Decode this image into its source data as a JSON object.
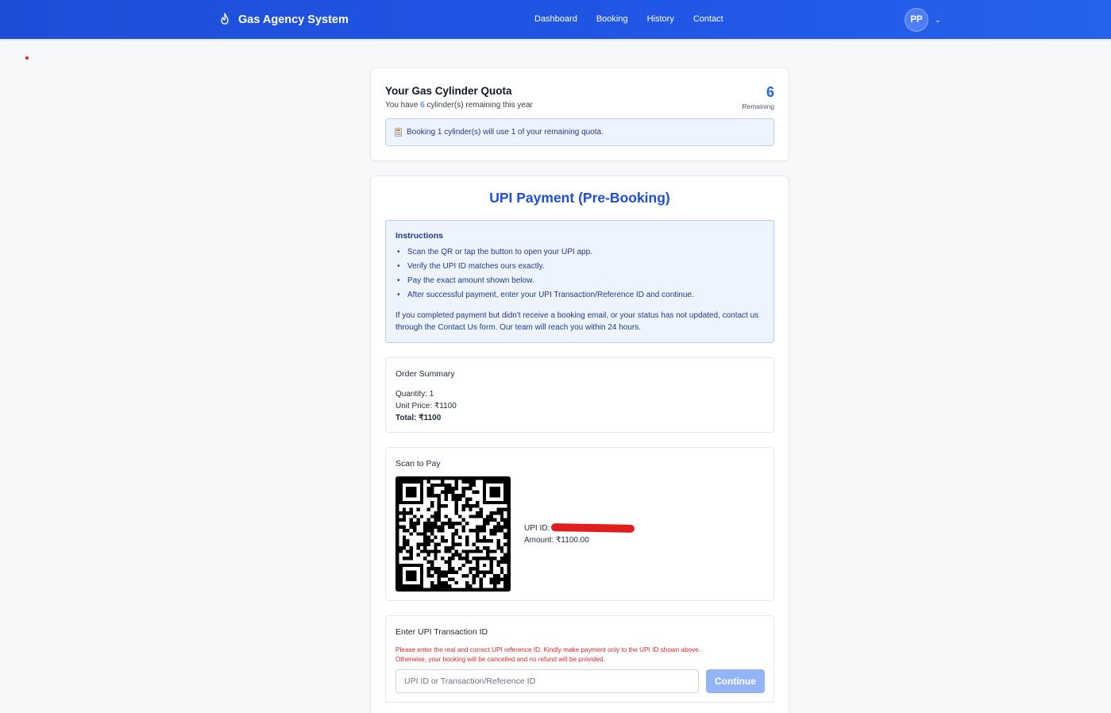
{
  "nav": {
    "brand": "Gas Agency System",
    "links": [
      "Dashboard",
      "Booking",
      "History",
      "Contact"
    ],
    "avatar_initials": "PP"
  },
  "quota": {
    "title": "Your Gas Cylinder Quota",
    "sub_prefix": "You have",
    "remaining": "6",
    "sub_suffix": "cylinder(s) remaining this year",
    "remaining_label": "Remaining",
    "note": "Booking 1 cylinder(s) will use 1 of your remaining quota."
  },
  "payment": {
    "title": "UPI Payment (Pre-Booking)",
    "instructions_title": "Instructions",
    "instructions": [
      "Scan the QR or tap the button to open your UPI app.",
      "Verify the UPI ID matches ours exactly.",
      "Pay the exact amount shown below.",
      "After successful payment, enter your UPI Transaction/Reference ID and continue."
    ],
    "help_text": "If you completed payment but didn't receive a booking email, or your status has not updated, contact us through the Contact Us form. Our team will reach you within 24 hours."
  },
  "summary": {
    "title": "Order Summary",
    "quantity": "Quantity: 1",
    "unit_price": "Unit Price: ₹1100",
    "total": "Total: ₹1100"
  },
  "scan": {
    "title": "Scan to Pay",
    "upi_label": "UPI ID:",
    "amount": "Amount: ₹1100.00"
  },
  "txn": {
    "title": "Enter UPI Transaction ID",
    "warning_line1": "Please enter the real and correct UPI reference ID. Kindly make payment only to the UPI ID shown above.",
    "warning_line2": "Otherwise, your booking will be cancelled and no refund will be provided.",
    "placeholder": "UPI ID or Transaction/Reference ID",
    "button": "Continue"
  },
  "colors": {
    "primary": "#2563eb",
    "navbar": "#1d4ed8",
    "warning": "#dc2626",
    "redaction": "#e11d1d",
    "button_disabled": "#93b4f7"
  },
  "icons": {
    "brand": "flame-icon",
    "avatar_menu": "chevron-down-icon",
    "quota_note": "calculator-icon"
  }
}
